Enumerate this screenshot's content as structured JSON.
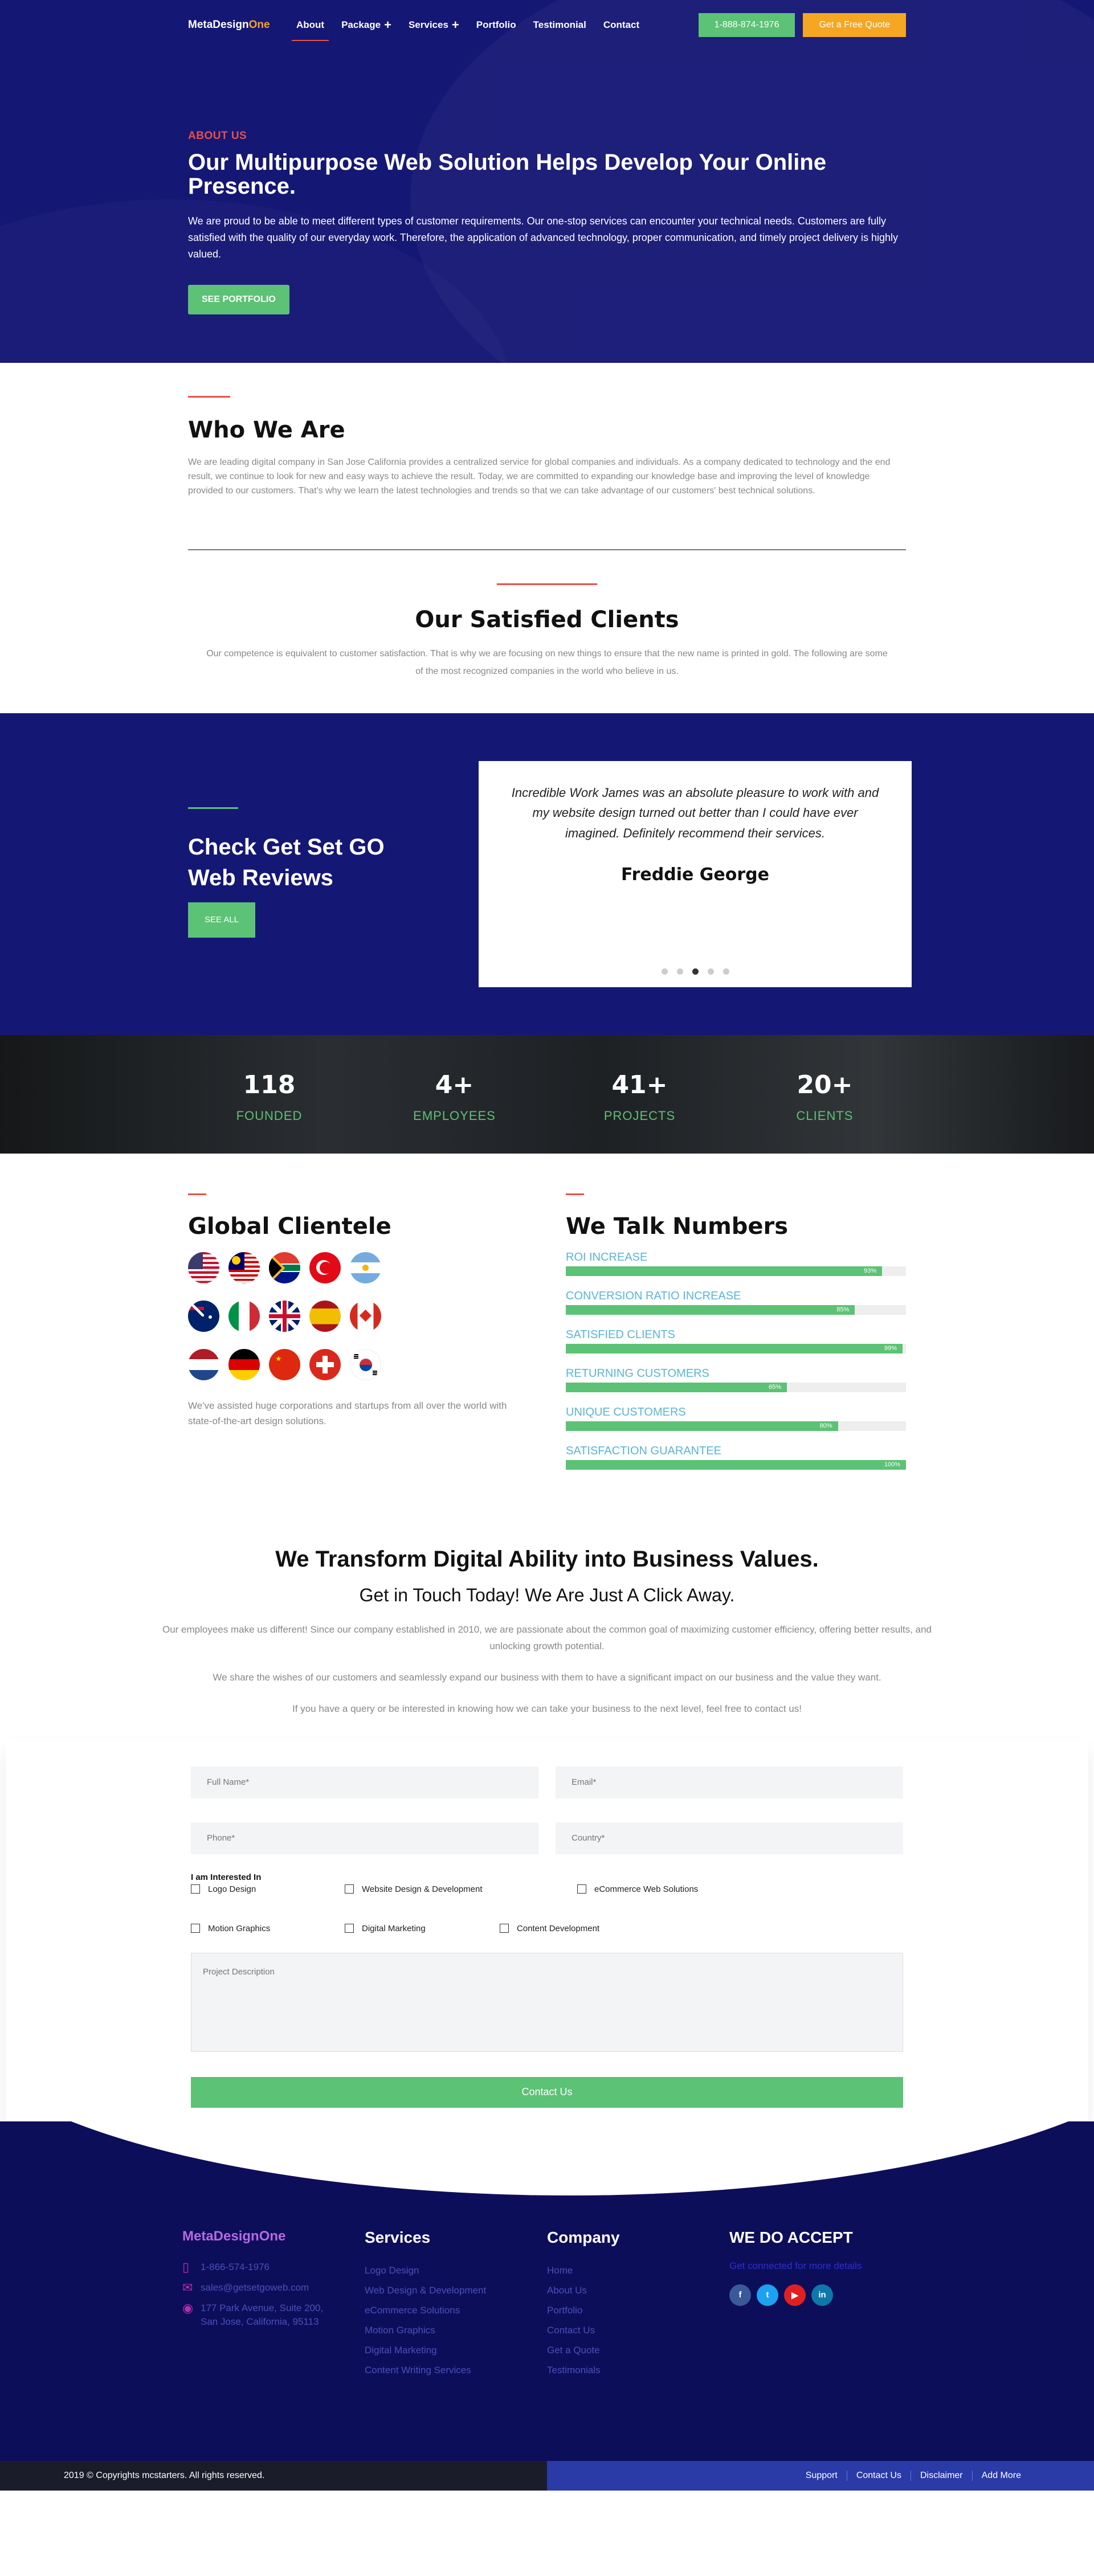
{
  "nav": {
    "logo_a": "MetaDesign",
    "logo_b": "One",
    "items": [
      "About",
      "Package",
      "Services",
      "Portfolio",
      "Testimonial",
      "Contact"
    ],
    "phone": "1-888-874-1976",
    "quote": "Get a Free Quote"
  },
  "hero": {
    "eyebrow": "ABOUT US",
    "title": "Our Multipurpose Web Solution Helps Develop Your Online Presence.",
    "text": "We are proud to be able to meet different types of customer requirements. Our one-stop services can encounter your technical needs. Customers are fully satisfied with the quality of our everyday work. Therefore, the application of advanced technology, proper communication, and timely project delivery is highly valued.",
    "button": "SEE PORTFOLIO"
  },
  "who": {
    "title": "Who We Are",
    "text": "We are leading digital company in San Jose California provides a centralized service for global companies and individuals. As a company dedicated to technology and the end result, we continue to look for new and easy ways to achieve the result. Today, we are committed to expanding our knowledge base and improving the level of knowledge provided to our customers. That's why we learn the latest technologies and trends so that we can take advantage of our customers' best technical solutions."
  },
  "clients": {
    "title": "Our Satisfied Clients",
    "text": "Our competence is equivalent to customer satisfaction. That is why we are focusing on new things to ensure that the new name is printed in gold. The following are some of the most recognized companies in the world who believe in us."
  },
  "reviews": {
    "title_1": "Check Get Set GO",
    "title_2": "Web Reviews",
    "button": "SEE ALL",
    "quote": "Incredible Work James was an absolute pleasure to work with and my website design turned out better than I could have ever imagined. Definitely recommend their services.",
    "author": "Freddie George",
    "active_dot": 3
  },
  "stats": [
    {
      "num": "118",
      "label": "FOUNDED"
    },
    {
      "num": "4+",
      "label": "EMPLOYEES"
    },
    {
      "num": "41+",
      "label": "PROJECTS"
    },
    {
      "num": "20+",
      "label": "CLIENTS"
    }
  ],
  "global": {
    "title": "Global Clientele",
    "flags": [
      "us-flag-icon",
      "malaysia-flag-icon",
      "south-africa-flag-icon",
      "turkey-flag-icon",
      "argentina-flag-icon",
      "australia-flag-icon",
      "italy-flag-icon",
      "uk-flag-icon",
      "spain-flag-icon",
      "canada-flag-icon",
      "netherlands-flag-icon",
      "germany-flag-icon",
      "china-flag-icon",
      "switzerland-flag-icon",
      "south-korea-flag-icon"
    ],
    "text": "We've assisted huge corporations and startups from all over the world with state-of-the-art design solutions."
  },
  "numbers": {
    "title": "We Talk Numbers",
    "bars": [
      {
        "label": "ROI INCREASE",
        "percent": 93,
        "text": "93%"
      },
      {
        "label": "CONVERSION RATIO INCREASE",
        "percent": 85,
        "text": "85%"
      },
      {
        "label": "SATISFIED CLIENTS",
        "percent": 99,
        "text": "99%"
      },
      {
        "label": "RETURNING CUSTOMERS",
        "percent": 65,
        "text": "65%"
      },
      {
        "label": "UNIQUE CUSTOMERS",
        "percent": 80,
        "text": "80%"
      },
      {
        "label": "SATISFACTION GUARANTEE",
        "percent": 100,
        "text": "100%"
      }
    ]
  },
  "transform": {
    "title": "We Transform Digital Ability into Business Values.",
    "subtitle": "Get in Touch Today! We Are Just A Click Away.",
    "p1": "Our employees make us different! Since our company established in 2010, we are passionate about the common goal of maximizing customer efficiency, offering better results, and unlocking growth potential.",
    "p2": "We share the wishes of our customers and seamlessly expand our business with them to have a significant impact on our business and the value they want.",
    "p3": "If you have a query or be interested in knowing how we can take your business to the next level, feel free to contact us!"
  },
  "form": {
    "name": "Full Name*",
    "email": "Email*",
    "phone": "Phone*",
    "country": "Country*",
    "interest_label": "I am Interested In",
    "options_row1": [
      "Logo Design",
      "Website Design & Development",
      "eCommerce Web Solutions"
    ],
    "options_row2": [
      "Motion Graphics",
      "Digital Marketing",
      "Content Development"
    ],
    "description": "Project Description",
    "submit": "Contact Us"
  },
  "footer": {
    "logo": "MetaDesignOne",
    "phone": "1-866-574-1976",
    "email": "sales@getsetgoweb.com",
    "address": "177 Park Avenue, Suite 200, San Jose, California, 95113",
    "services_title": "Services",
    "services": [
      "Logo Design",
      "Web Design & Development",
      "eCommerce Solutions",
      "Motion Graphics",
      "Digital Marketing",
      "Content Writing Services"
    ],
    "company_title": "Company",
    "company": [
      "Home",
      "About Us",
      "Portfolio",
      "Contact Us",
      "Get a Quote",
      "Testimonials"
    ],
    "accept_title": "WE DO ACCEPT",
    "accept_text": "Get connected for more details",
    "socials": [
      "facebook-icon",
      "twitter-icon",
      "youtube-icon",
      "linkedin-icon"
    ]
  },
  "bottom": {
    "copyright": "2019 © Copyrights mcstarters. All rights reserved.",
    "links": [
      "Support",
      "Contact Us",
      "Disclaimer",
      "Add More"
    ]
  }
}
